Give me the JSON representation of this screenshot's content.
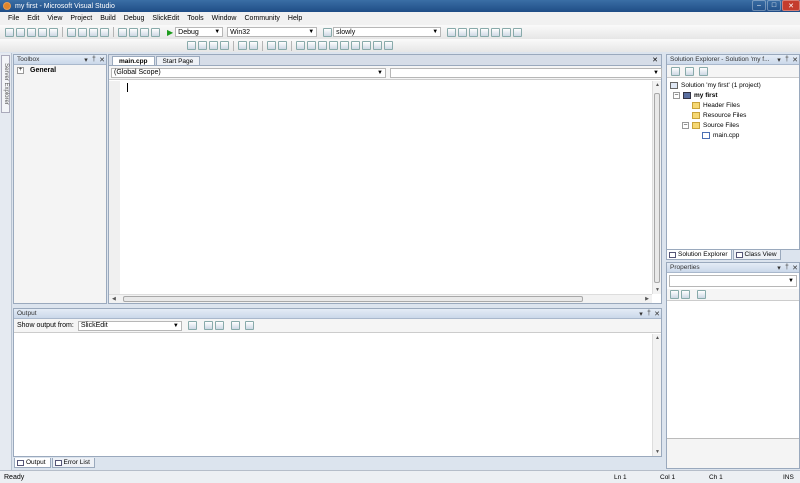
{
  "window": {
    "title": "my first - Microsoft Visual Studio"
  },
  "menu": [
    "File",
    "Edit",
    "View",
    "Project",
    "Build",
    "Debug",
    "SlickEdit",
    "Tools",
    "Window",
    "Community",
    "Help"
  ],
  "toolbar": {
    "config": "Debug",
    "platform": "Win32",
    "find_value": "slowly"
  },
  "left_strip": {
    "server_explorer": "Server Explorer"
  },
  "toolbox": {
    "title": "Toolbox",
    "group": "General"
  },
  "editor": {
    "tabs": [
      {
        "label": "main.cpp",
        "active": true
      },
      {
        "label": "Start Page",
        "active": false
      }
    ],
    "scope": "(Global Scope)",
    "member": ""
  },
  "output": {
    "title": "Output",
    "show_from_label": "Show output from:",
    "source": "SlickEdit"
  },
  "bottom_tabs": [
    {
      "label": "Output",
      "active": true
    },
    {
      "label": "Error List",
      "active": false
    }
  ],
  "solution_explorer": {
    "title": "Solution Explorer - Solution 'my f...",
    "tree": {
      "solution": "Solution 'my first' (1 project)",
      "project": "my first",
      "folders": [
        "Header Files",
        "Resource Files",
        "Source Files"
      ],
      "file": "main.cpp"
    },
    "tabs": [
      {
        "label": "Solution Explorer",
        "active": true
      },
      {
        "label": "Class View",
        "active": false
      }
    ]
  },
  "properties": {
    "title": "Properties"
  },
  "status": {
    "text": "Ready",
    "ln": "Ln 1",
    "col": "Col 1",
    "ch": "Ch 1",
    "ins": "INS"
  }
}
